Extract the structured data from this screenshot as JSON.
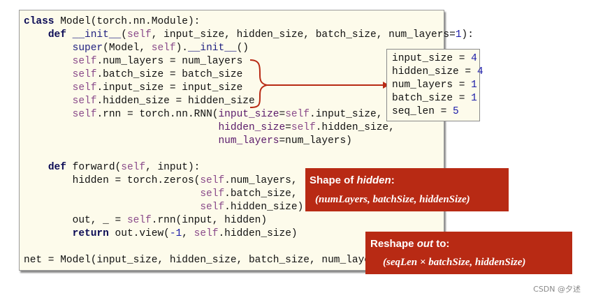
{
  "code": {
    "lines": [
      [
        {
          "t": "class",
          "k": "kw"
        },
        {
          "t": " Model(torch.nn.Module):",
          "k": "def"
        }
      ],
      [
        {
          "t": "    ",
          "k": "def"
        },
        {
          "t": "def",
          "k": "kw"
        },
        {
          "t": " ",
          "k": "def"
        },
        {
          "t": "__init__",
          "k": "fn"
        },
        {
          "t": "(",
          "k": "def"
        },
        {
          "t": "self",
          "k": "self"
        },
        {
          "t": ", input_size, hidden_size, batch_size, num_layers=",
          "k": "def"
        },
        {
          "t": "1",
          "k": "num"
        },
        {
          "t": "):",
          "k": "def"
        }
      ],
      [
        {
          "t": "        ",
          "k": "def"
        },
        {
          "t": "super",
          "k": "fn"
        },
        {
          "t": "(Model, ",
          "k": "def"
        },
        {
          "t": "self",
          "k": "self"
        },
        {
          "t": ").",
          "k": "def"
        },
        {
          "t": "__init__",
          "k": "fn"
        },
        {
          "t": "()",
          "k": "def"
        }
      ],
      [
        {
          "t": "        ",
          "k": "def"
        },
        {
          "t": "self",
          "k": "self"
        },
        {
          "t": ".num_layers = num_layers",
          "k": "def"
        }
      ],
      [
        {
          "t": "        ",
          "k": "def"
        },
        {
          "t": "self",
          "k": "self"
        },
        {
          "t": ".batch_size = batch_size",
          "k": "def"
        }
      ],
      [
        {
          "t": "        ",
          "k": "def"
        },
        {
          "t": "self",
          "k": "self"
        },
        {
          "t": ".input_size = input_size",
          "k": "def"
        }
      ],
      [
        {
          "t": "        ",
          "k": "def"
        },
        {
          "t": "self",
          "k": "self"
        },
        {
          "t": ".hidden_size = hidden_size",
          "k": "def"
        }
      ],
      [
        {
          "t": "        ",
          "k": "def"
        },
        {
          "t": "self",
          "k": "self"
        },
        {
          "t": ".rnn = torch.nn.RNN(",
          "k": "def"
        },
        {
          "t": "input_size",
          "k": "param"
        },
        {
          "t": "=",
          "k": "def"
        },
        {
          "t": "self",
          "k": "self"
        },
        {
          "t": ".input_size,",
          "k": "def"
        }
      ],
      [
        {
          "t": "                                ",
          "k": "def"
        },
        {
          "t": "hidden_size",
          "k": "param"
        },
        {
          "t": "=",
          "k": "def"
        },
        {
          "t": "self",
          "k": "self"
        },
        {
          "t": ".hidden_size,",
          "k": "def"
        }
      ],
      [
        {
          "t": "                                ",
          "k": "def"
        },
        {
          "t": "num_layers",
          "k": "param"
        },
        {
          "t": "=num_layers)",
          "k": "def"
        }
      ],
      [],
      [
        {
          "t": "    ",
          "k": "def"
        },
        {
          "t": "def",
          "k": "kw"
        },
        {
          "t": " forward(",
          "k": "def"
        },
        {
          "t": "self",
          "k": "self"
        },
        {
          "t": ", input):",
          "k": "def"
        }
      ],
      [
        {
          "t": "        hidden = torch.zeros(",
          "k": "def"
        },
        {
          "t": "self",
          "k": "self"
        },
        {
          "t": ".num_layers,",
          "k": "def"
        }
      ],
      [
        {
          "t": "                             ",
          "k": "def"
        },
        {
          "t": "self",
          "k": "self"
        },
        {
          "t": ".batch_size,",
          "k": "def"
        }
      ],
      [
        {
          "t": "                             ",
          "k": "def"
        },
        {
          "t": "self",
          "k": "self"
        },
        {
          "t": ".hidden_size)",
          "k": "def"
        }
      ],
      [
        {
          "t": "        out, _ = ",
          "k": "def"
        },
        {
          "t": "self",
          "k": "self"
        },
        {
          "t": ".rnn(input, hidden)",
          "k": "def"
        }
      ],
      [
        {
          "t": "        ",
          "k": "def"
        },
        {
          "t": "return",
          "k": "kw"
        },
        {
          "t": " out.view(",
          "k": "def"
        },
        {
          "t": "-1",
          "k": "num"
        },
        {
          "t": ", ",
          "k": "def"
        },
        {
          "t": "self",
          "k": "self"
        },
        {
          "t": ".hidden_size)",
          "k": "def"
        }
      ],
      [],
      [
        {
          "t": "net = Model(input_size, hidden_size, batch_size, num_layers)",
          "k": "def"
        }
      ]
    ]
  },
  "params": [
    [
      {
        "t": "input_size = ",
        "k": "def"
      },
      {
        "t": "4",
        "k": "num"
      }
    ],
    [
      {
        "t": "hidden_size = ",
        "k": "def"
      },
      {
        "t": "4",
        "k": "num"
      }
    ],
    [
      {
        "t": "num_layers = ",
        "k": "def"
      },
      {
        "t": "1",
        "k": "num"
      }
    ],
    [
      {
        "t": "batch_size = ",
        "k": "def"
      },
      {
        "t": "1",
        "k": "num"
      }
    ],
    [
      {
        "t": "seq_len = ",
        "k": "def"
      },
      {
        "t": "5",
        "k": "num"
      }
    ]
  ],
  "callout_hidden": {
    "title_prefix": "Shape of ",
    "title_emph": "hidden",
    "title_suffix": ":",
    "formula": "(numLayers, batchSize, hiddenSize)"
  },
  "callout_out": {
    "title_prefix": "Reshape ",
    "title_emph": "out",
    "title_suffix": " to:",
    "formula": "(seqLen × batchSize, hiddenSize)"
  },
  "watermark": "CSDN @夕述",
  "colors": {
    "panel_bg": "#fdfbeb",
    "callout_bg": "#b82a14",
    "arrow": "#b82a14"
  }
}
